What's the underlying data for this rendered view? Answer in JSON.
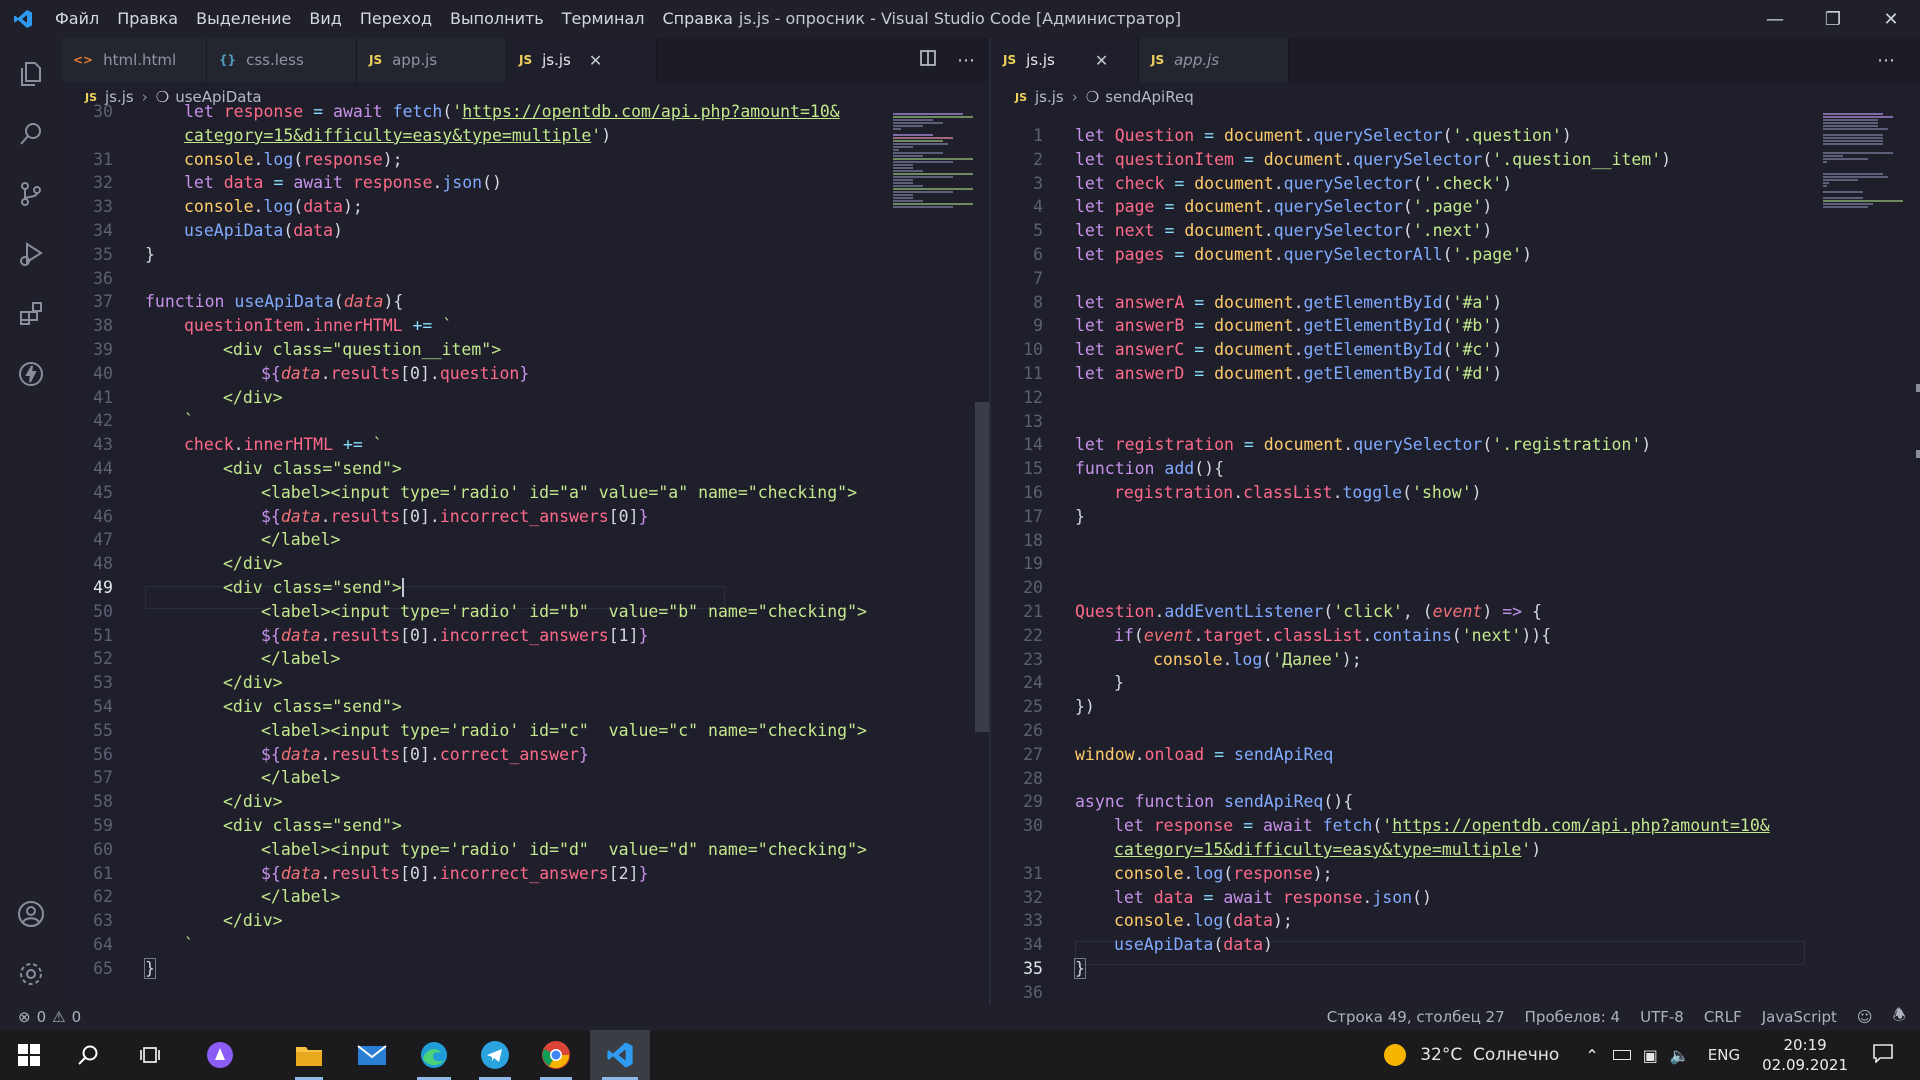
{
  "window": {
    "title": "js.js - опросник - Visual Studio Code [Администратор]",
    "menu": [
      "Файл",
      "Правка",
      "Выделение",
      "Вид",
      "Переход",
      "Выполнить",
      "Терминал",
      "Справка"
    ]
  },
  "activity_bar": {
    "icons": [
      "explorer-icon",
      "search-icon",
      "source-control-icon",
      "run-debug-icon",
      "extensions-icon",
      "thunder-icon"
    ],
    "bottom_icons": [
      "account-icon",
      "settings-gear-icon"
    ]
  },
  "left_editor": {
    "tabs": [
      {
        "icon": "<>",
        "label": "html.html",
        "active": false
      },
      {
        "icon": "{}",
        "label": "css.less",
        "active": false
      },
      {
        "icon": "JS",
        "label": "app.js",
        "active": false
      },
      {
        "icon": "JS",
        "label": "js.js",
        "active": true
      }
    ],
    "breadcrumb": {
      "file": "js.js",
      "symbol": "useApiData"
    },
    "cursor_line": 49
  },
  "right_editor": {
    "tabs": [
      {
        "icon": "JS",
        "label": "js.js",
        "active": true
      },
      {
        "icon": "JS",
        "label": "app.js",
        "active": false
      }
    ],
    "breadcrumb": {
      "file": "js.js",
      "symbol": "sendApiReq"
    },
    "cursor_line": 35
  },
  "status_bar": {
    "errors": "0",
    "warnings": "0",
    "position": "Строка 49, столбец 27",
    "indent": "Пробелов: 4",
    "encoding": "UTF-8",
    "eol": "CRLF",
    "language": "JavaScript"
  },
  "taskbar": {
    "apps": [
      "start-icon",
      "search-icon",
      "task-view-icon",
      "alice-icon",
      "file-explorer-icon",
      "mail-icon",
      "edge-icon",
      "telegram-icon",
      "chrome-icon",
      "vscode-icon"
    ],
    "weather": "32°C  Солнечно",
    "language": "ENG",
    "time": "20:19",
    "date": "02.09.2021"
  }
}
